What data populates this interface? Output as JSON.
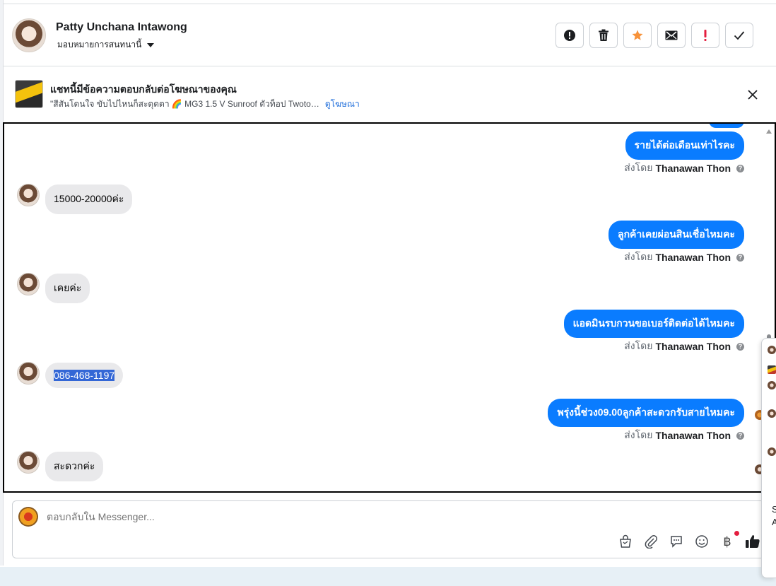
{
  "header": {
    "contact_name": "Patty Unchana Intawong",
    "assign_label": "มอบหมายการสนทนานี้"
  },
  "actions": [
    {
      "name": "report-spam-icon",
      "color": "#1c1e21"
    },
    {
      "name": "trash-icon",
      "color": "#1c1e21"
    },
    {
      "name": "star-icon",
      "color": "#f7923a"
    },
    {
      "name": "envelope-icon",
      "color": "#1c1e21"
    },
    {
      "name": "important-icon",
      "color": "#e41e3f"
    },
    {
      "name": "checkmark-icon",
      "color": "#1c1e21"
    }
  ],
  "ad_banner": {
    "title": "แชทนี้มีข้อความตอบกลับต่อโฆษณาของคุณ",
    "subtitle": "\"สีสันโดนใจ ขับไปไหนก็สะดุดตา 🌈 MG3 1.5 V Sunroof ตัวท็อป Twoto…",
    "link": "ดูโฆษณา"
  },
  "messages": [
    {
      "dir": "out",
      "text": "รายได้ต่อเดือนเท่าไรคะ",
      "sent_by_prefix": "ส่งโดย",
      "sender": "Thanawan Thon"
    },
    {
      "dir": "in",
      "text": "15000-20000ค่ะ"
    },
    {
      "dir": "out",
      "text": "ลูกค้าเคยผ่อนสินเชื่อไหมคะ",
      "sent_by_prefix": "ส่งโดย",
      "sender": "Thanawan Thon"
    },
    {
      "dir": "in",
      "text": "เคยค่ะ"
    },
    {
      "dir": "out",
      "text": "แอดมินรบกวนขอเบอร์ติดต่อได้ไหมคะ",
      "sent_by_prefix": "ส่งโดย",
      "sender": "Thanawan Thon"
    },
    {
      "dir": "in",
      "text": "086-468-1197",
      "selected": true
    },
    {
      "dir": "out",
      "text": "พรุ่งนี้ช่วง09.00ลูกค้าสะดวกรับสายไหมคะ",
      "sent_by_prefix": "ส่งโดย",
      "sender": "Thanawan Thon"
    },
    {
      "dir": "in",
      "text": "สะดวกค่ะ"
    }
  ],
  "composer": {
    "placeholder": "ตอบกลับใน Messenger...",
    "tools": [
      "shopping-bag-icon",
      "paperclip-icon",
      "saved-reply-icon",
      "emoji-icon",
      "baht-payment-icon",
      "thumbs-up-icon"
    ],
    "baht_symbol": "฿"
  },
  "right_panel": {
    "letters": [
      "S",
      "A"
    ]
  },
  "colors": {
    "outgoing_bubble": "#0a7cff",
    "incoming_bubble": "#e9e9eb",
    "accent_link": "#216fdb",
    "selection": "#3367d6"
  }
}
